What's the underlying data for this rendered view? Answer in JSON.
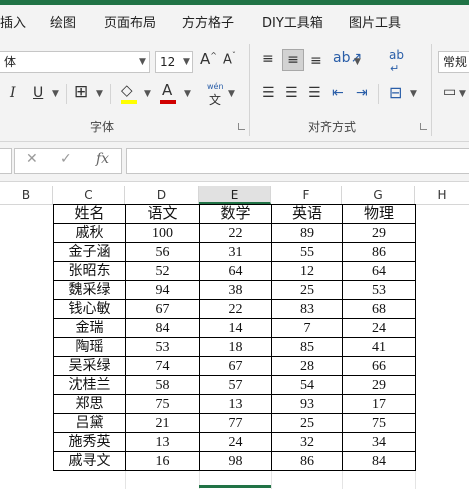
{
  "ribbon_tabs": [
    "插入",
    "绘图",
    "页面布局",
    "方方格子",
    "DIY工具箱",
    "图片工具"
  ],
  "ribbon": {
    "font_name": "体",
    "font_size": "12",
    "grow_font_icon": "A^",
    "shrink_font_icon": "A˅",
    "italic_icon": "I",
    "underline_icon": "U",
    "fill_color": "#ffff00",
    "font_color": "#d00000",
    "wen_label": "wén",
    "wen_char": "文",
    "font_group_label": "字体",
    "align_group_label": "对齐方式",
    "number_format": "常规",
    "wrap_icon": "ab",
    "accent_color": "#217346"
  },
  "formula_bar": {
    "cancel_icon": "✕",
    "enter_icon": "✓",
    "fx_label": "fx",
    "value": ""
  },
  "columns": [
    "B",
    "C",
    "D",
    "E",
    "F",
    "G",
    "H"
  ],
  "selected_column": "E",
  "table": {
    "headers": [
      "姓名",
      "语文",
      "数学",
      "英语",
      "物理"
    ],
    "rows": [
      [
        "戚秋",
        "100",
        "22",
        "89",
        "29"
      ],
      [
        "金子涵",
        "56",
        "31",
        "55",
        "86"
      ],
      [
        "张昭东",
        "52",
        "64",
        "12",
        "64"
      ],
      [
        "魏采绿",
        "94",
        "38",
        "25",
        "53"
      ],
      [
        "钱心敏",
        "67",
        "22",
        "83",
        "68"
      ],
      [
        "金瑞",
        "84",
        "14",
        "7",
        "24"
      ],
      [
        "陶瑶",
        "53",
        "18",
        "85",
        "41"
      ],
      [
        "吴采绿",
        "74",
        "67",
        "28",
        "66"
      ],
      [
        "沈桂兰",
        "58",
        "57",
        "54",
        "29"
      ],
      [
        "郑思",
        "75",
        "13",
        "93",
        "17"
      ],
      [
        "吕黛",
        "21",
        "77",
        "25",
        "75"
      ],
      [
        "施秀英",
        "13",
        "24",
        "32",
        "34"
      ],
      [
        "戚寻文",
        "16",
        "98",
        "86",
        "84"
      ]
    ]
  }
}
